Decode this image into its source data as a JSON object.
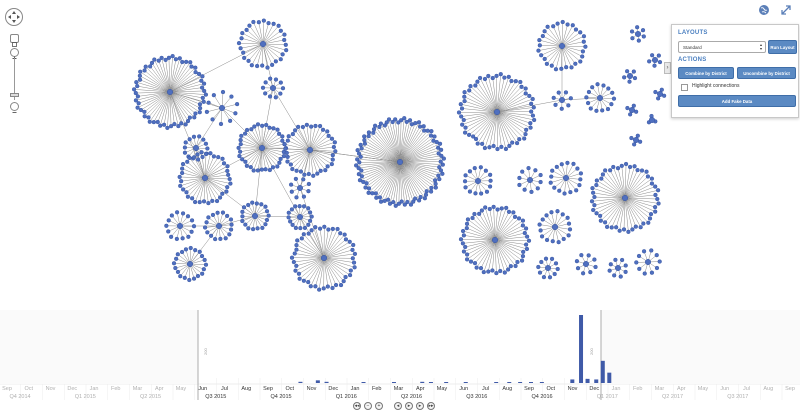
{
  "panel": {
    "layouts_heading": "LAYOUTS",
    "layout_selected": "Standard",
    "run_layout_label": "Run Layout",
    "actions_heading": "ACTIONS",
    "combine_label": "Combine by District",
    "uncombine_label": "Uncombine by District",
    "highlight_label": "Highlight connections",
    "highlight_checked": false,
    "add_fake_label": "Add Fake Data"
  },
  "icons": {
    "globe": "globe-icon",
    "fullscreen": "fullscreen-icon",
    "pan": "pan-arrows-icon",
    "fit": "fit-to-view-icon",
    "zoom_in": "zoom-in-icon",
    "zoom_out": "zoom-out-icon"
  },
  "colors": {
    "node_fill": "#4f6fbf",
    "node_stroke": "#2f4d9a",
    "edge": "#8a8a8a",
    "accent": "#4a7fc0",
    "bar": "#3f5aa8"
  },
  "timeline": {
    "axis_value": "200",
    "months": [
      {
        "label": "Sep",
        "active": false
      },
      {
        "label": "Oct",
        "active": false
      },
      {
        "label": "Nov",
        "active": false
      },
      {
        "label": "Dec",
        "active": false
      },
      {
        "label": "Jan",
        "active": false
      },
      {
        "label": "Feb",
        "active": false
      },
      {
        "label": "Mar",
        "active": false
      },
      {
        "label": "Apr",
        "active": false
      },
      {
        "label": "May",
        "active": false
      },
      {
        "label": "Jun",
        "active": true
      },
      {
        "label": "Jul",
        "active": true
      },
      {
        "label": "Aug",
        "active": true
      },
      {
        "label": "Sep",
        "active": true
      },
      {
        "label": "Oct",
        "active": true
      },
      {
        "label": "Nov",
        "active": true
      },
      {
        "label": "Dec",
        "active": true
      },
      {
        "label": "Jan",
        "active": true
      },
      {
        "label": "Feb",
        "active": true
      },
      {
        "label": "Mar",
        "active": true
      },
      {
        "label": "Apr",
        "active": true
      },
      {
        "label": "May",
        "active": true
      },
      {
        "label": "Jun",
        "active": true
      },
      {
        "label": "Jul",
        "active": true
      },
      {
        "label": "Aug",
        "active": true
      },
      {
        "label": "Sep",
        "active": true
      },
      {
        "label": "Oct",
        "active": true
      },
      {
        "label": "Nov",
        "active": true
      },
      {
        "label": "Dec",
        "active": true
      },
      {
        "label": "Jan",
        "active": false
      },
      {
        "label": "Feb",
        "active": false
      },
      {
        "label": "Mar",
        "active": false
      },
      {
        "label": "Apr",
        "active": false
      },
      {
        "label": "May",
        "active": false
      },
      {
        "label": "Jun",
        "active": false
      },
      {
        "label": "Jul",
        "active": false
      },
      {
        "label": "Aug",
        "active": false
      },
      {
        "label": "Sep",
        "active": false
      }
    ],
    "quarters": [
      {
        "label": "Q4 2014",
        "active": false
      },
      {
        "label": "Q1 2015",
        "active": false
      },
      {
        "label": "Q2 2015",
        "active": false
      },
      {
        "label": "Q3 2015",
        "active": true
      },
      {
        "label": "Q4 2015",
        "active": true
      },
      {
        "label": "Q1 2016",
        "active": true
      },
      {
        "label": "Q2 2016",
        "active": true
      },
      {
        "label": "Q3 2016",
        "active": true
      },
      {
        "label": "Q4 2016",
        "active": true
      },
      {
        "label": "Q1 2017",
        "active": false
      },
      {
        "label": "Q2 2017",
        "active": false
      },
      {
        "label": "Q3 2017",
        "active": false
      }
    ],
    "controls": [
      "rewind-icon",
      "zoom-out-icon",
      "zoom-in-icon",
      "step-back-icon",
      "play-icon",
      "step-forward-icon",
      "fast-forward-icon"
    ],
    "bars": [
      {
        "month_index": 13.4,
        "value": 4
      },
      {
        "month_index": 14.2,
        "value": 9
      },
      {
        "month_index": 14.6,
        "value": 4
      },
      {
        "month_index": 16.3,
        "value": 3
      },
      {
        "month_index": 17.7,
        "value": 3
      },
      {
        "month_index": 19.0,
        "value": 4
      },
      {
        "month_index": 19.4,
        "value": 3
      },
      {
        "month_index": 20.1,
        "value": 3
      },
      {
        "month_index": 21.0,
        "value": 3
      },
      {
        "month_index": 22.4,
        "value": 3
      },
      {
        "month_index": 23.0,
        "value": 3
      },
      {
        "month_index": 23.5,
        "value": 3
      },
      {
        "month_index": 24.0,
        "value": 3
      },
      {
        "month_index": 24.5,
        "value": 3
      },
      {
        "month_index": 25.9,
        "value": 12
      },
      {
        "month_index": 26.3,
        "value": 230
      },
      {
        "month_index": 26.6,
        "value": 14
      },
      {
        "month_index": 27.0,
        "value": 12
      },
      {
        "month_index": 27.3,
        "value": 75
      },
      {
        "month_index": 27.6,
        "value": 35
      }
    ]
  }
}
